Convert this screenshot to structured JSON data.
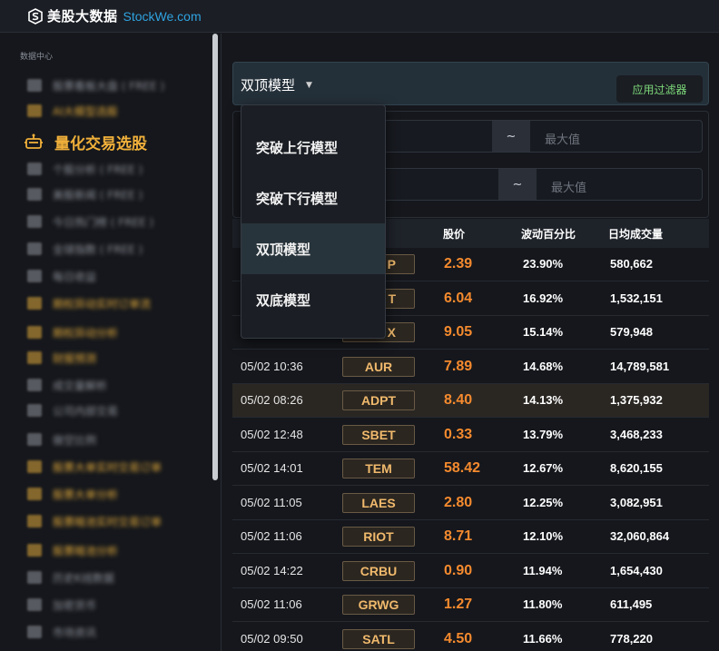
{
  "header": {
    "brand_cn": "美股大数据",
    "brand_en": "StockWe.com"
  },
  "sidebar": {
    "section_title": "数据中心",
    "active_item": "量化交易选股",
    "blurred_items": [
      {
        "label": "股票看板大盘 ( FREE )",
        "color": "#8e9199"
      },
      {
        "label": "AI大模型选股",
        "color": "#e0a93a"
      },
      {
        "label": "个股分析 ( FREE )",
        "color": "#8e9199"
      },
      {
        "label": "美股新闻 ( FREE )",
        "color": "#8e9199"
      },
      {
        "label": "今日热门榜 ( FREE )",
        "color": "#8e9199"
      },
      {
        "label": "全球指数 ( FREE )",
        "color": "#8e9199"
      },
      {
        "label": "每日收益",
        "color": "#8e9199"
      },
      {
        "label": "期权异动实时订单流",
        "color": "#e0a93a"
      },
      {
        "label": "期权异动分析",
        "color": "#e0a93a"
      },
      {
        "label": "财报预测",
        "color": "#e0a93a"
      },
      {
        "label": "成交量解析",
        "color": "#8e9199"
      },
      {
        "label": "公司内部交易",
        "color": "#8e9199"
      },
      {
        "label": "做空比例",
        "color": "#8e9199"
      },
      {
        "label": "股票大单实时交易订单",
        "color": "#e0a93a"
      },
      {
        "label": "股票大单分析",
        "color": "#e0a93a"
      },
      {
        "label": "股票暗池实时交易订单",
        "color": "#e0a93a"
      },
      {
        "label": "股票暗池分析",
        "color": "#e0a93a"
      },
      {
        "label": "历史K线数据",
        "color": "#8e9199"
      },
      {
        "label": "加密货币",
        "color": "#8e9199"
      },
      {
        "label": "市场资讯",
        "color": "#8e9199"
      }
    ]
  },
  "filter": {
    "selected_model": "双顶模型",
    "apply_label": "应用过滤器",
    "tilde": "~",
    "max_placeholder": "最大值"
  },
  "dropdown": {
    "options": [
      "突破上行模型",
      "突破下行模型",
      "双顶模型",
      "双底模型"
    ],
    "active_index": 2
  },
  "table": {
    "columns": [
      "股价",
      "波动百分比",
      "日均成交量"
    ],
    "rows": [
      {
        "time": "",
        "symbol": "P",
        "price": "2.39",
        "pct": "23.90%",
        "volume": "580,662"
      },
      {
        "time": "",
        "symbol": "T",
        "price": "6.04",
        "pct": "16.92%",
        "volume": "1,532,151"
      },
      {
        "time": "",
        "symbol": "X",
        "price": "9.05",
        "pct": "15.14%",
        "volume": "579,948"
      },
      {
        "time": "05/02 10:36",
        "symbol": "AUR",
        "price": "7.89",
        "pct": "14.68%",
        "volume": "14,789,581"
      },
      {
        "time": "05/02 08:26",
        "symbol": "ADPT",
        "price": "8.40",
        "pct": "14.13%",
        "volume": "1,375,932"
      },
      {
        "time": "05/02 12:48",
        "symbol": "SBET",
        "price": "0.33",
        "pct": "13.79%",
        "volume": "3,468,233"
      },
      {
        "time": "05/02 14:01",
        "symbol": "TEM",
        "price": "58.42",
        "pct": "12.67%",
        "volume": "8,620,155"
      },
      {
        "time": "05/02 11:05",
        "symbol": "LAES",
        "price": "2.80",
        "pct": "12.25%",
        "volume": "3,082,951"
      },
      {
        "time": "05/02 11:06",
        "symbol": "RIOT",
        "price": "8.71",
        "pct": "12.10%",
        "volume": "32,060,864"
      },
      {
        "time": "05/02 14:22",
        "symbol": "CRBU",
        "price": "0.90",
        "pct": "11.94%",
        "volume": "1,654,430"
      },
      {
        "time": "05/02 11:06",
        "symbol": "GRWG",
        "price": "1.27",
        "pct": "11.80%",
        "volume": "611,495"
      },
      {
        "time": "05/02 09:50",
        "symbol": "SATL",
        "price": "4.50",
        "pct": "11.66%",
        "volume": "778,220"
      }
    ],
    "highlighted_row": 4
  },
  "colors": {
    "accent_gold": "#f0b03a",
    "price_orange": "#f58a2e",
    "apply_green": "#7dd87a",
    "brand_blue": "#2fa3e0"
  }
}
